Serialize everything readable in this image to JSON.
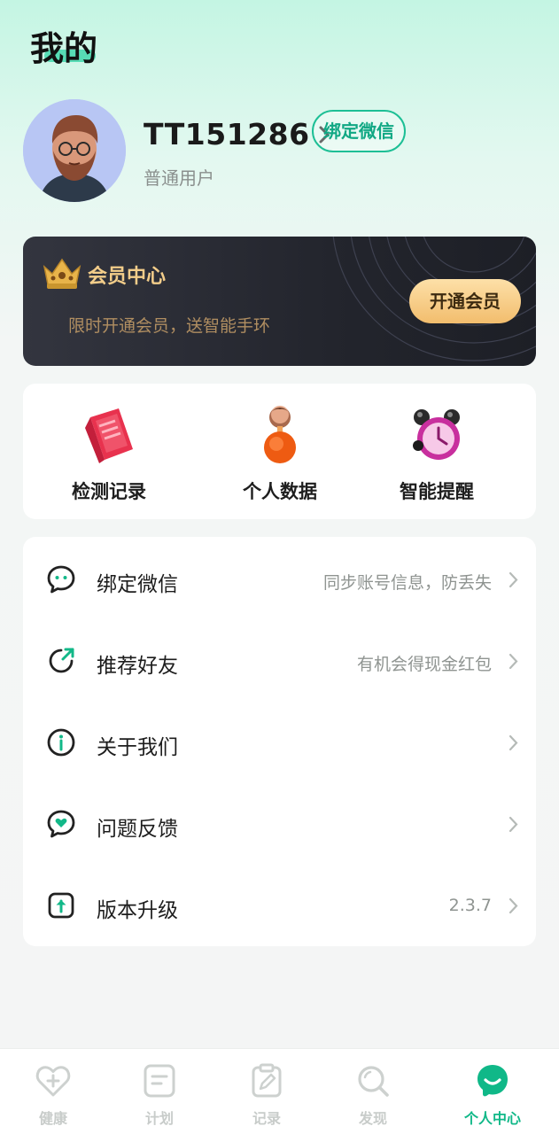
{
  "header": {
    "title": "我的"
  },
  "profile": {
    "username": "TT151286",
    "bind_badge": "绑定微信",
    "user_type": "普通用户"
  },
  "vip": {
    "title": "会员中心",
    "subtitle": "限时开通会员，送智能手环",
    "button": "开通会员",
    "accent_color": "#f3cd8a"
  },
  "shortcuts": [
    {
      "label": "检测记录",
      "icon": "document-icon"
    },
    {
      "label": "个人数据",
      "icon": "person-icon"
    },
    {
      "label": "智能提醒",
      "icon": "alarm-clock-icon"
    }
  ],
  "menu": [
    {
      "label": "绑定微信",
      "desc": "同步账号信息，防丢失",
      "icon": "chat-bubble-icon"
    },
    {
      "label": "推荐好友",
      "desc": "有机会得现金红包",
      "icon": "share-arrow-icon"
    },
    {
      "label": "关于我们",
      "desc": "",
      "icon": "info-icon"
    },
    {
      "label": "问题反馈",
      "desc": "",
      "icon": "feedback-heart-icon"
    },
    {
      "label": "版本升级",
      "desc": "2.3.7",
      "icon": "upgrade-icon"
    }
  ],
  "tabbar": {
    "active_color": "#10b888",
    "tabs": [
      {
        "label": "健康",
        "icon": "heart-plus-icon"
      },
      {
        "label": "计划",
        "icon": "plan-doc-icon"
      },
      {
        "label": "记录",
        "icon": "clipboard-icon"
      },
      {
        "label": "发现",
        "icon": "search-icon"
      },
      {
        "label": "个人中心",
        "icon": "profile-icon"
      }
    ]
  }
}
